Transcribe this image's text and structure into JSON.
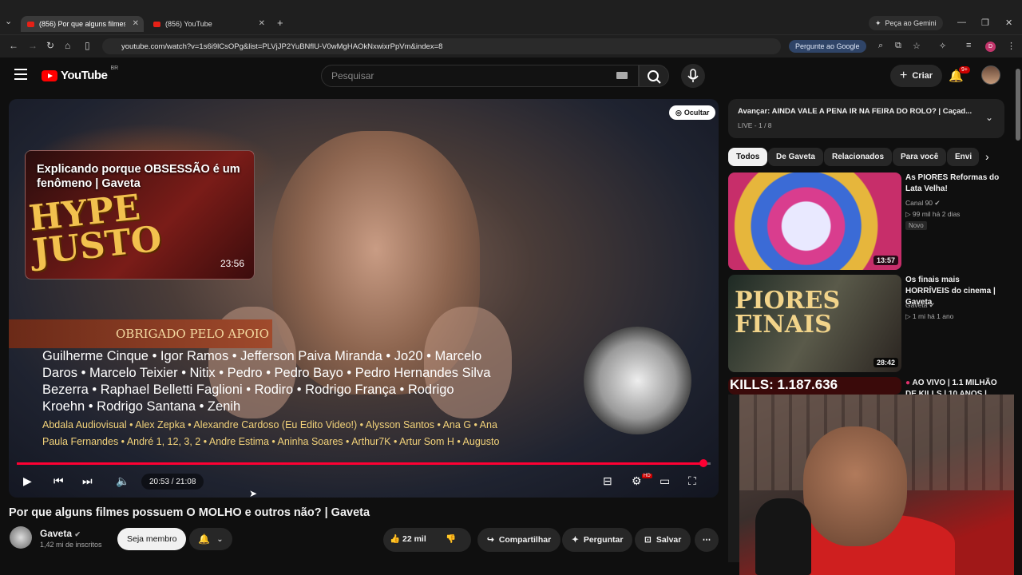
{
  "browser": {
    "tabs": [
      {
        "label": "(856) Por que alguns filmes po..."
      },
      {
        "label": "(856) YouTube"
      }
    ],
    "gemini_label": "Peça ao Gemini",
    "url": "youtube.com/watch?v=1s6i9lCsOPg&list=PLVjJP2YuBNflU-V0wMgHAOkNxwixrPpVm&index=8",
    "ask_google": "Pergunte ao Google",
    "profile_initial": "D"
  },
  "header": {
    "logo_text": "YouTube",
    "country": "BR",
    "search_placeholder": "Pesquisar",
    "create_label": "Criar",
    "notification_count": "9+"
  },
  "player": {
    "hide_label": "Ocultar",
    "endcard": {
      "title": "Explicando porque OBSESSÃO é um fenômeno | Gaveta",
      "duration": "23:56",
      "art_text": "HYPE JUSTO"
    },
    "banner_text": "OBRIGADO PELO APOIO",
    "credits_lines": [
      "Guilherme Cinque • Igor Ramos • Jefferson Paiva Miranda • Jo20 • Marcelo",
      "Daros • Marcelo Teixier • Nitix • Pedro • Pedro Bayo • Pedro Hernandes Silva",
      "Bezerra • Raphael Belletti Faglioni • Rodiro • Rodrigo França • Rodrigo",
      "Kroehn • Rodrigo Santana • Zenih"
    ],
    "credits_small": [
      "Abdala Audiovisual • Alex Zepka • Alexandre Cardoso (Eu Edito Video!) • Alysson Santos • Ana G • Ana",
      "Paula Fernandes • André 1, 12, 3, 2 • Andre Estima • Aninha Soares • Arthur7K • Artur Som H • Augusto"
    ],
    "progress": 0.99,
    "time": "20:53 / 21:08",
    "hd_badge": "HD"
  },
  "video": {
    "title": "Por que alguns filmes possuem O MOLHO e outros não? | Gaveta",
    "channel": "Gaveta",
    "subscribers": "1,42 mi de inscritos",
    "join_label": "Seja membro",
    "likes": "22 mil",
    "share_label": "Compartilhar",
    "ask_label": "Perguntar",
    "save_label": "Salvar"
  },
  "sidebar": {
    "queue": {
      "title": "Avançar: AINDA VALE A PENA IR NA FEIRA DO ROLO? | Caçad...",
      "sub": "LIVE - 1 / 8"
    },
    "chips": [
      "Todos",
      "De Gaveta",
      "Relacionados",
      "Para você",
      "Envi"
    ],
    "recommendations": [
      {
        "title": "As PIORES Reformas do Lata Velha!",
        "channel": "Canal 90",
        "meta": "▷ 99 mil  há 2 dias",
        "badge": "Novo",
        "duration": "13:57"
      },
      {
        "title": "Os finais mais HORRÍVEIS do cinema | Gaveta",
        "channel": "Gaveta",
        "meta": "▷ 1 mi  há 1 ano",
        "duration": "28:42",
        "thumb_text": "PIORES FINAIS"
      },
      {
        "title": "AO VIVO | 1.1 MILHÃO DE KILLS | 10 ANOS |",
        "thumb_text": "KILLS: 1.187.636"
      }
    ]
  }
}
